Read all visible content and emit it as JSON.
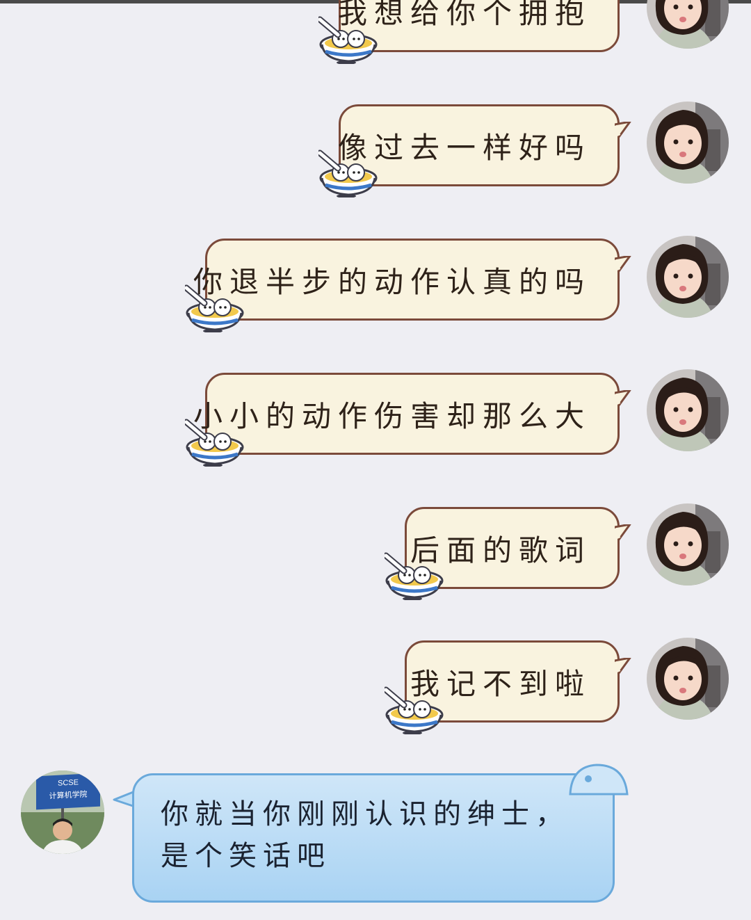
{
  "chat": {
    "messages": [
      {
        "sender": "self",
        "text": "我想给你个拥抱"
      },
      {
        "sender": "self",
        "text": "像过去一样好吗"
      },
      {
        "sender": "self",
        "text": "你退半步的动作认真的吗"
      },
      {
        "sender": "self",
        "text": "小小的动作伤害却那么大"
      },
      {
        "sender": "self",
        "text": "后面的歌词"
      },
      {
        "sender": "self",
        "text": "我记不到啦"
      },
      {
        "sender": "other",
        "text": "你就当你刚刚认识的绅士，是个笑话吧"
      }
    ],
    "other_avatar": {
      "sign_line1": "SCSE",
      "sign_line2": "计算机学院"
    }
  },
  "colors": {
    "background": "#eeeef3",
    "outgoing_bubble": "#f9f3df",
    "outgoing_border": "#7b4a3a",
    "incoming_bubble": "#b9dcf6",
    "incoming_border": "#6aa9db"
  }
}
